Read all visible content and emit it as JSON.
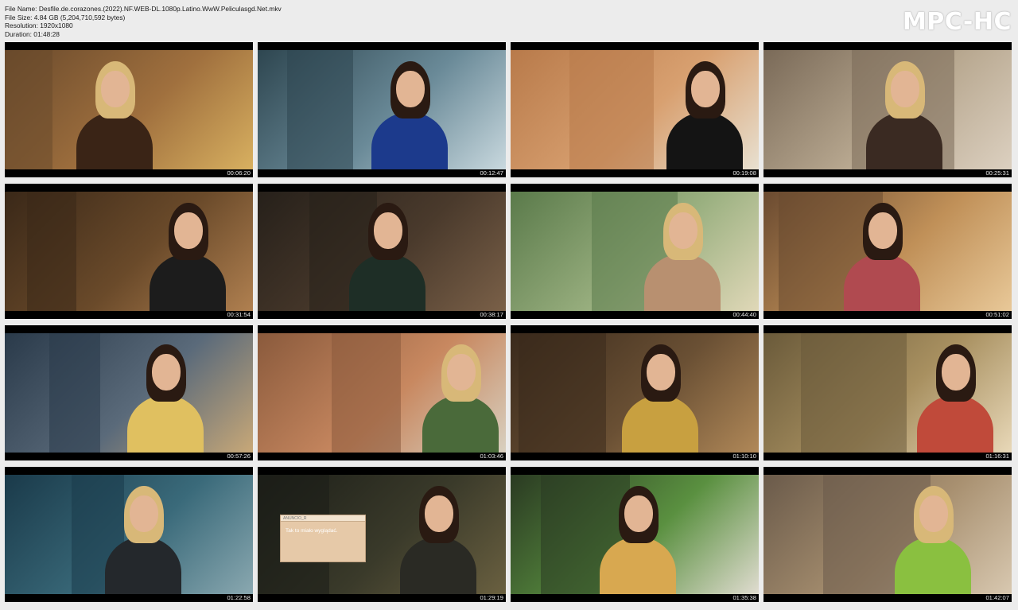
{
  "info": {
    "file_name": "File Name: Desfile.de.corazones.(2022).NF.WEB-DL.1080p.Latino.WwW.Peliculasgd.Net.mkv",
    "file_size": "File Size: 4.84 GB (5,204,710,592 bytes)",
    "resolution": "Resolution: 1920x1080",
    "duration": "Duration: 01:48:28"
  },
  "logo": "MPC-HC",
  "thumbnails": [
    {
      "timestamp": "00:06:20",
      "palette": [
        "#6a4a2c",
        "#a0703e",
        "#d8b060",
        "#3a2416"
      ]
    },
    {
      "timestamp": "00:12:47",
      "palette": [
        "#2e4650",
        "#6a8a98",
        "#c8d8de",
        "#1c3a8c"
      ]
    },
    {
      "timestamp": "00:19:08",
      "palette": [
        "#b87a4a",
        "#d8a070",
        "#e8e0d0",
        "#141414"
      ]
    },
    {
      "timestamp": "00:25:31",
      "palette": [
        "#7a6a58",
        "#b8a890",
        "#dcd0c0",
        "#3a2a22"
      ]
    },
    {
      "timestamp": "00:31:54",
      "palette": [
        "#3a2818",
        "#6a4a2a",
        "#b08050",
        "#1c1c1c"
      ]
    },
    {
      "timestamp": "00:38:17",
      "palette": [
        "#26201a",
        "#4a3a2c",
        "#7a6048",
        "#1e2e26"
      ]
    },
    {
      "timestamp": "00:44:40",
      "palette": [
        "#5a7a4a",
        "#9ab080",
        "#e0d8b8",
        "#b89070"
      ]
    },
    {
      "timestamp": "00:51:02",
      "palette": [
        "#6a4a30",
        "#c09058",
        "#e8c898",
        "#b04a50"
      ]
    },
    {
      "timestamp": "00:57:26",
      "palette": [
        "#2a3a4a",
        "#5a6a7a",
        "#c8a878",
        "#e0c060"
      ]
    },
    {
      "timestamp": "01:03:46",
      "palette": [
        "#8a5a3c",
        "#c88860",
        "#d8d0c0",
        "#4a6a3a"
      ]
    },
    {
      "timestamp": "01:10:10",
      "palette": [
        "#3a2a1c",
        "#6a5034",
        "#b08858",
        "#c8a040"
      ]
    },
    {
      "timestamp": "01:16:31",
      "palette": [
        "#6a5a3a",
        "#a89060",
        "#e8d8b8",
        "#c04a3a"
      ]
    },
    {
      "timestamp": "01:22:58",
      "palette": [
        "#1a3a4a",
        "#3a6a7a",
        "#8aa8b0",
        "#24282c"
      ]
    },
    {
      "timestamp": "01:29:19",
      "palette": [
        "#1c1e18",
        "#3a3a2a",
        "#6a6040",
        "#2a2a24"
      ]
    },
    {
      "timestamp": "01:35:38",
      "palette": [
        "#2a3a22",
        "#5a9040",
        "#e0dcd0",
        "#d8a850"
      ]
    },
    {
      "timestamp": "01:42:07",
      "palette": [
        "#6a5a4a",
        "#a89070",
        "#d8c8b0",
        "#8ac040"
      ]
    }
  ],
  "subtitle_window": {
    "title": "ANUNCIO_R",
    "text": "Tak to miało wyglądać."
  }
}
